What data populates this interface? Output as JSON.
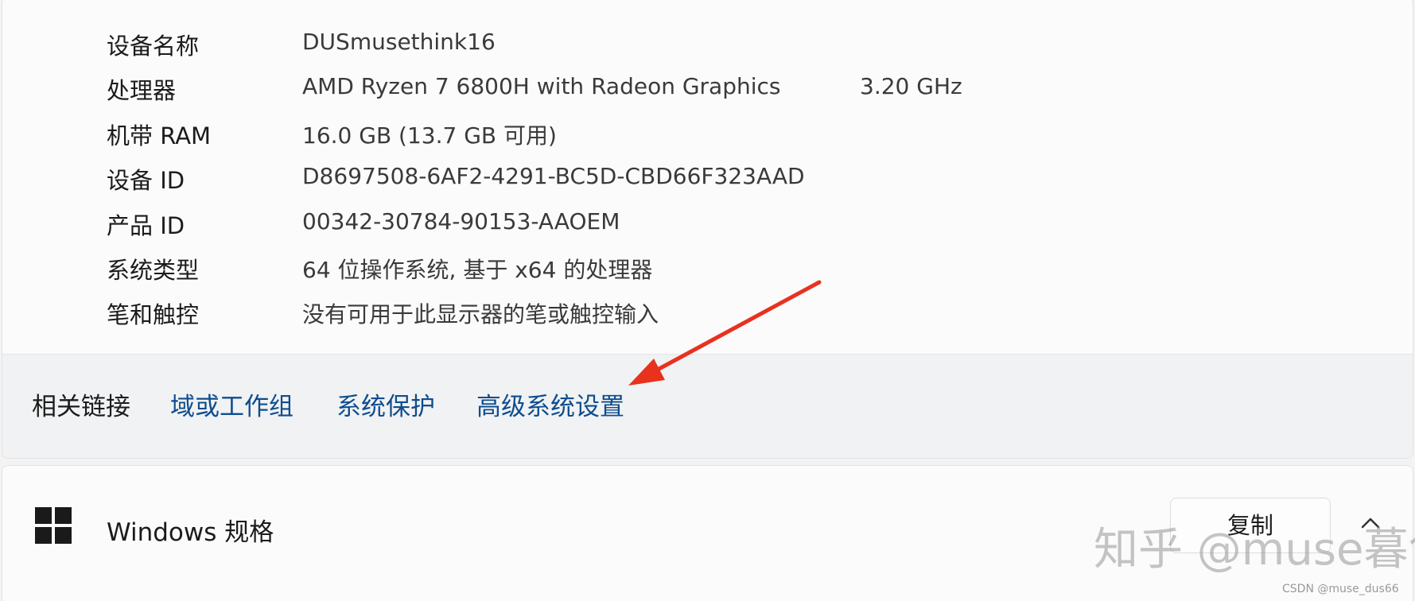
{
  "specs": [
    {
      "label": "设备名称",
      "value": "DUSmusethink16"
    },
    {
      "label": "处理器",
      "value": "AMD Ryzen 7 6800H with Radeon Graphics",
      "extra": "3.20 GHz"
    },
    {
      "label": "机带 RAM",
      "value": "16.0 GB (13.7 GB 可用)"
    },
    {
      "label": "设备 ID",
      "value": "D8697508-6AF2-4291-BC5D-CBD66F323AAD"
    },
    {
      "label": "产品 ID",
      "value": "00342-30784-90153-AAOEM"
    },
    {
      "label": "系统类型",
      "value": "64 位操作系统, 基于 x64 的处理器"
    },
    {
      "label": "笔和触控",
      "value": "没有可用于此显示器的笔或触控输入"
    }
  ],
  "related": {
    "label": "相关链接",
    "links": [
      "域或工作组",
      "系统保护",
      "高级系统设置"
    ]
  },
  "windows_spec": {
    "title": "Windows 规格",
    "copy_label": "复制",
    "icon": "windows-logo-icon",
    "expand_icon": "chevron-up-icon"
  },
  "overlay": {
    "watermark": "知乎 @muse暮色",
    "source": "CSDN @muse_dus66",
    "arrow_color": "#e8321e"
  },
  "colors": {
    "link": "#0e4d8f",
    "background": "#f3f3f3",
    "card": "#fbfbfb"
  }
}
